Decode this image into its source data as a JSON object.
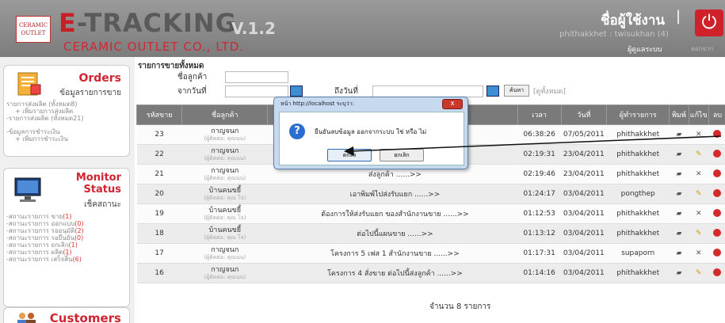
{
  "header": {
    "logo_text": "CERAMIC OUTLET",
    "brand_e": "E",
    "brand_rest": "-TRACKING",
    "version": "V.1.2",
    "subtitle": "CERAMIC OUTLET CO., LTD.",
    "user_title": "ชื่อผู้ใช้งาน",
    "user_sep": "|",
    "user_name": "phithakkhet : twisukhan (4)",
    "user_role": "ผู้ดูแลระบบ",
    "logout_icon": "power-icon",
    "logout_label": "ออกจากระบบ"
  },
  "sidebar": {
    "orders": {
      "title": "Orders",
      "sub": "ข้อมูลรายการขาย",
      "links": [
        {
          "text": "รายการส่งผลิต (ทั้งหมด8)",
          "indent": false
        },
        {
          "text": "+ เพิ่มรายการส่งผลิต",
          "indent": true
        },
        {
          "text": "-รายการส่งผลิต (ทั้งหมด21)",
          "indent": false
        },
        {
          "text": "",
          "indent": false
        },
        {
          "text": "-ข้อมูลการชำระเงิน",
          "indent": false
        },
        {
          "text": "+ เพิ่มการชำระเงิน",
          "indent": true
        }
      ]
    },
    "monitor": {
      "title": "Monitor",
      "title2": "Status",
      "sub": "เช็คสถานะ",
      "links": [
        {
          "text": "-สถานะรายการ ขาย",
          "count": "(1)"
        },
        {
          "text": "-สถานะรายการ ออกแบบ",
          "count": "(0)"
        },
        {
          "text": "-สถานะรายการ รออนุมัติ",
          "count": "(2)"
        },
        {
          "text": "-สถานะรายการ รอยืนยัน",
          "count": "(0)"
        },
        {
          "text": "-สถานะรายการ ยกเลิก",
          "count": "(1)"
        },
        {
          "text": "-สถานะรายการ ผลิต",
          "count": "(1)"
        },
        {
          "text": "-สถานะรายการ เสร็จสิ้น",
          "count": "(6)"
        }
      ]
    },
    "customers": {
      "title": "Customers"
    }
  },
  "main": {
    "section_title": "รายการขายทั้งหมด",
    "customer_label": "ชื่อลูกค้า",
    "from_label": "จากวันที่",
    "to_label": "ถึงวันที่",
    "search_label": "ค้นหา",
    "all_label": "[ดูทั้งหมด]",
    "columns": [
      "รหัสขาย",
      "ชื่อลูกค้า",
      "",
      "เวลา",
      "วันที่",
      "ผู้ทำรายการ",
      "พิมพ์",
      "แก้ไข",
      "ลบ"
    ],
    "rows": [
      {
        "id": "23",
        "cust": "กาญจนก",
        "cust_sub": "(ผู้ติดต่อ: คุณนน)",
        "note": "",
        "time": "06:38:26",
        "date": "07/05/2011",
        "user": "phithakkhet"
      },
      {
        "id": "22",
        "cust": "กาญจนก",
        "cust_sub": "(ผู้ติดต่อ: คุณนน)",
        "note": "",
        "time": "02:19:31",
        "date": "23/04/2011",
        "user": "phithakkhet"
      },
      {
        "id": "21",
        "cust": "กาญจนก",
        "cust_sub": "(ผู้ติดต่อ: คุณนน)",
        "note": "ส่งลูกค้า ......>>",
        "time": "02:19:46",
        "date": "23/04/2011",
        "user": "phithakkhet"
      },
      {
        "id": "20",
        "cust": "บ้านคนขยี้",
        "cust_sub": "(ผู้ติดต่อ: คุณ โจ)",
        "note": "เอาพิมพ์ไปส่งรับแยก ......>>",
        "time": "01:24:17",
        "date": "03/04/2011",
        "user": "pongthep"
      },
      {
        "id": "19",
        "cust": "บ้านคนขยี้",
        "cust_sub": "(ผู้ติดต่อ: คุณ โจ)",
        "note": "ต้องการให้ส่งรับแยก ของสำนักงานขาย ......>>",
        "time": "01:12:53",
        "date": "03/04/2011",
        "user": "phithakkhet"
      },
      {
        "id": "18",
        "cust": "บ้านคนขยี้",
        "cust_sub": "(ผู้ติดต่อ: คุณ โจ)",
        "note": "ต่อไปนี้แผนขาย ......>>",
        "time": "01:13:12",
        "date": "03/04/2011",
        "user": "phithakkhet"
      },
      {
        "id": "17",
        "cust": "กาญจนก",
        "cust_sub": "(ผู้ติดต่อ: คุณนน)",
        "note": "โครงการ 5 เฟส 1 สำนักงานขาย ......>>",
        "time": "01:17:31",
        "date": "03/04/2011",
        "user": "supaporn"
      },
      {
        "id": "16",
        "cust": "กาญจนก",
        "cust_sub": "(ผู้ติดต่อ: คุณนน)",
        "note": "โครงการ 4 สั่งขาย ต่อไปนี้ส่งลูกค้า ......>>",
        "time": "01:14:16",
        "date": "03/04/2011",
        "user": "phithakkhet"
      }
    ],
    "footer": "จำนวน 8 รายการ"
  },
  "dialog": {
    "title": "หน้า http://localhost ระบุว่า:",
    "close": "x",
    "icon": "question-icon",
    "message": "ยืนยันลบข้อมูล    ออกจากระบบ  ใช่ หรือ ไม่",
    "ok": "ตกลง",
    "cancel": "ยกเลิก"
  },
  "colors": {
    "brand_red": "#d5232e",
    "header_grey": "#8a8a8a",
    "table_header": "#7a7a7a"
  }
}
